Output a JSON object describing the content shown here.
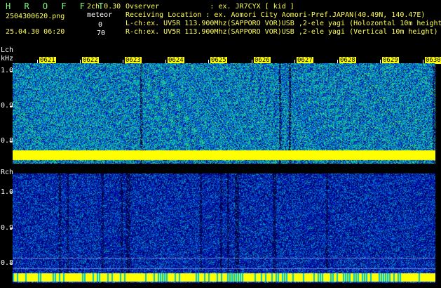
{
  "header": {
    "brand": "H R O F F T",
    "filename": "2504300620.png",
    "datetime": "25.04.30 06:20",
    "mode": "2ch 0.30",
    "meteor_label": "meteor",
    "count_l": "0",
    "count_r": "70",
    "info_lines": [
      "Ovserver            : ex. JR7CYX [ kid ]",
      "Receiving Location : ex. Aomori City Aomori-Pref.JAPAN(40.49N, 140.47E)",
      "L-ch:ex. UV5R 113.900Mhz(SAPPORO VOR)USB ,2-ele yagi (Holozontal 10m height)",
      "R-ch:ex. UV5R 113.900Mhz(SAPPORO VOR)USB ,2-ele yagi (Vertical 10m height)"
    ]
  },
  "lch": {
    "label": "Lch",
    "unit": "kHz",
    "ticks": [
      "1.0",
      "0.9",
      "0.8"
    ]
  },
  "rch": {
    "label": "Rch",
    "ticks": [
      "1.0",
      "0.9",
      "0.8"
    ]
  },
  "time_ticks": [
    "0621",
    "0622",
    "0623",
    "0624",
    "0625",
    "0626",
    "0627",
    "0628",
    "0629",
    "0630"
  ],
  "colors": {
    "noise_bg": "#0000aa",
    "signal_band": "#ffff00",
    "tick_bg": "#ffff00",
    "header_brand": "#7fff7f"
  }
}
